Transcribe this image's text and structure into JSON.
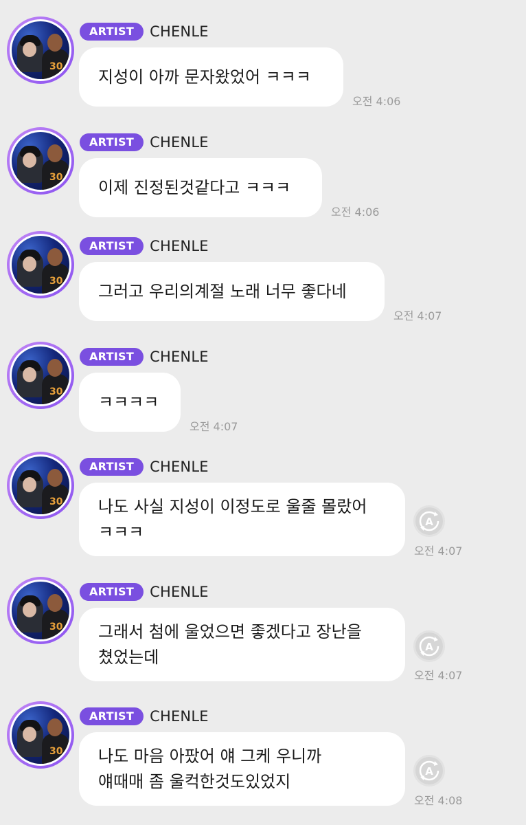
{
  "sender": {
    "badge": "ARTIST",
    "name": "CHENLE"
  },
  "avatar_description": "avatar-photo",
  "messages": [
    {
      "text": "지성이 아까 문자왔었어 ㅋㅋㅋ",
      "time": "오전 4:06",
      "translate": false
    },
    {
      "text": "이제 진정된것같다고 ㅋㅋㅋ",
      "time": "오전 4:06",
      "translate": false
    },
    {
      "text": "그러고 우리의계절 노래 너무 좋다네",
      "time": "오전 4:07",
      "translate": false
    },
    {
      "text": "ㅋㅋㅋㅋ",
      "time": "오전 4:07",
      "translate": false
    },
    {
      "text": "나도 사실 지성이 이정도로 울줄 몰랐어\nㅋㅋㅋ",
      "time": "오전 4:07",
      "translate": true
    },
    {
      "text": "그래서 첨에 울었으면 좋겠다고 장난을\n쳤었는데",
      "time": "오전 4:07",
      "translate": true
    },
    {
      "text": "나도 마음 아팠어 얘 그케 우니까\n얘때매 좀 울컥한것도있었지",
      "time": "오전 4:08",
      "translate": true
    }
  ]
}
